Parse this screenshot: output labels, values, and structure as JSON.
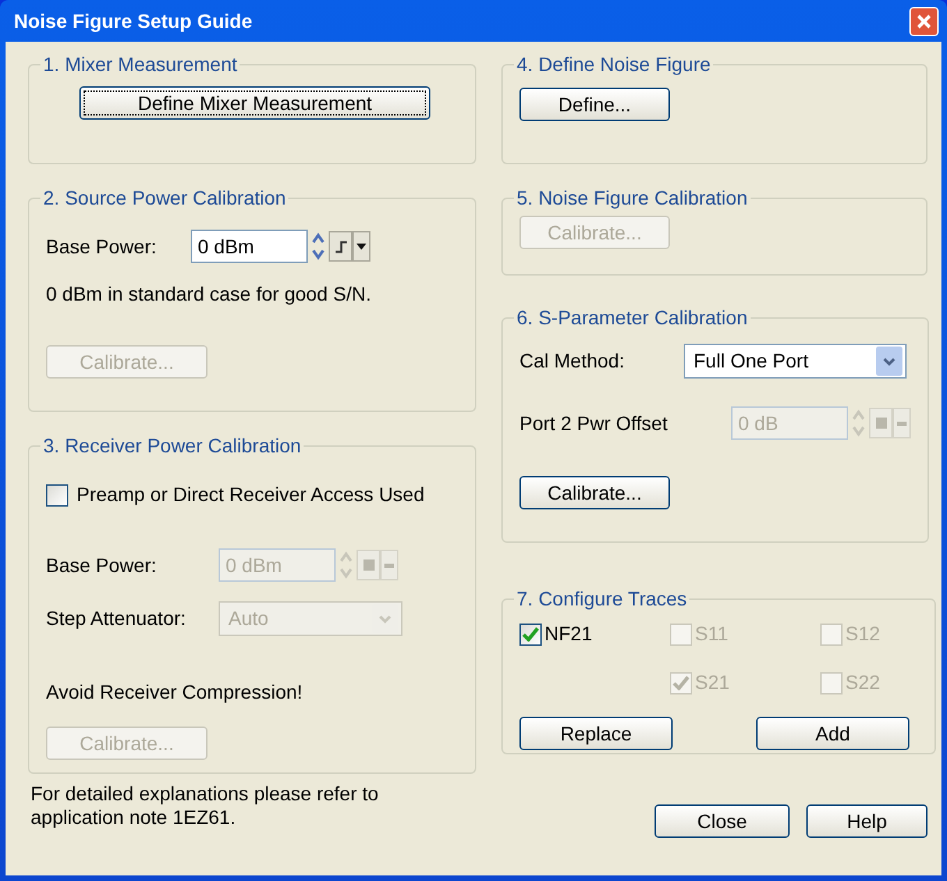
{
  "window": {
    "title": "Noise Figure Setup Guide"
  },
  "mixer": {
    "title": "1. Mixer Measurement",
    "button": {
      "label": "Define Mixer Measurement",
      "disabled": false
    }
  },
  "source": {
    "title": "2. Source Power Calibration",
    "base_power": {
      "label": "Base Power:",
      "value": "0 dBm",
      "disabled": false
    },
    "note": "0 dBm in standard case for good S/N.",
    "button": {
      "label": "Calibrate...",
      "disabled": true
    }
  },
  "receiver": {
    "title": "3. Receiver Power Calibration",
    "checkbox": {
      "label": "Preamp or Direct Receiver Access Used",
      "checked": false,
      "disabled": false
    },
    "base_power": {
      "label": "Base Power:",
      "value": "0 dBm",
      "disabled": true
    },
    "step_attenuator": {
      "label": "Step Attenuator:",
      "value": "Auto",
      "disabled": true
    },
    "warning": "Avoid Receiver Compression!",
    "button": {
      "label": "Calibrate...",
      "disabled": true
    }
  },
  "footer_note": "For detailed explanations please refer to application note 1EZ61.",
  "noise_figure": {
    "title": "4. Define Noise Figure",
    "button": {
      "label": "Define...",
      "disabled": false
    }
  },
  "nf_calibration": {
    "title": "5. Noise Figure Calibration",
    "button": {
      "label": "Calibrate...",
      "disabled": true
    }
  },
  "sparam": {
    "title": "6. S-Parameter Calibration",
    "cal_method": {
      "label": "Cal Method:",
      "value": "Full One Port",
      "disabled": false
    },
    "port2_offset": {
      "label": "Port 2 Pwr Offset",
      "value": "0 dB",
      "disabled": true
    },
    "button": {
      "label": "Calibrate...",
      "disabled": false
    }
  },
  "traces": {
    "title": "7. Configure Traces",
    "checkboxes": [
      {
        "label": "NF21",
        "checked": true,
        "disabled": false
      },
      {
        "label": "S11",
        "checked": false,
        "disabled": true
      },
      {
        "label": "S12",
        "checked": false,
        "disabled": true
      },
      {
        "label": "S21",
        "checked": true,
        "disabled": true
      },
      {
        "label": "S22",
        "checked": false,
        "disabled": true
      }
    ],
    "buttons": [
      {
        "label": "Replace",
        "disabled": false
      },
      {
        "label": "Add",
        "disabled": false
      }
    ]
  },
  "dialog_buttons": [
    {
      "label": "Close",
      "disabled": false
    },
    {
      "label": "Help",
      "disabled": false
    }
  ]
}
